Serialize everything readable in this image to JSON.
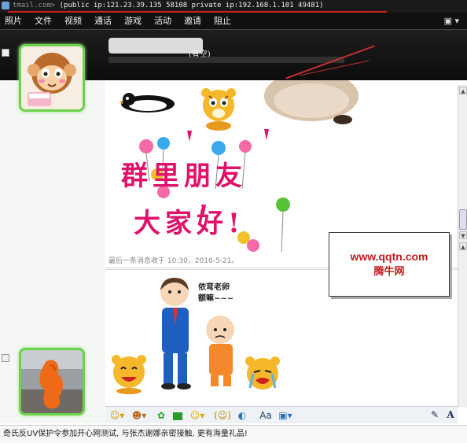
{
  "window": {
    "title_visible": "(public ip:121.23.39.135 58108 private ip:192.168.1.101 49481)",
    "title_prefix": "tmail.com>"
  },
  "menu": {
    "items": [
      "照片",
      "文件",
      "视频",
      "通话",
      "游戏",
      "活动",
      "邀请",
      "阻止"
    ],
    "right_icon": "menu-dropdown-icon"
  },
  "contact": {
    "status": "(有空)"
  },
  "chat": {
    "message_text_1": "群里朋友",
    "message_text_2": "大家好!",
    "last_message_time": "最后一条消息收于 10:30，2010-5-21。",
    "sticker_caption": "侬弯老卵\n额嘛~~~"
  },
  "toolbar": {
    "icons": [
      "emoticon-icon",
      "wink-icon",
      "nudge-icon",
      "background-icon",
      "gift-icon",
      "voice-clip-icon",
      "game-icon",
      "font-icon",
      "image-icon"
    ]
  },
  "status_bar": {
    "text": "奇氏反UV保护令参加开心网测试, 与张杰谢娜亲密接触, 更有海量礼品!"
  },
  "watermark": {
    "url": "www.qqtn.com",
    "name": "腾牛网"
  },
  "colors": {
    "accent_green": "#6bd34a",
    "big_text_pink": "#e0116a",
    "watermark_red": "#c41c1c"
  }
}
